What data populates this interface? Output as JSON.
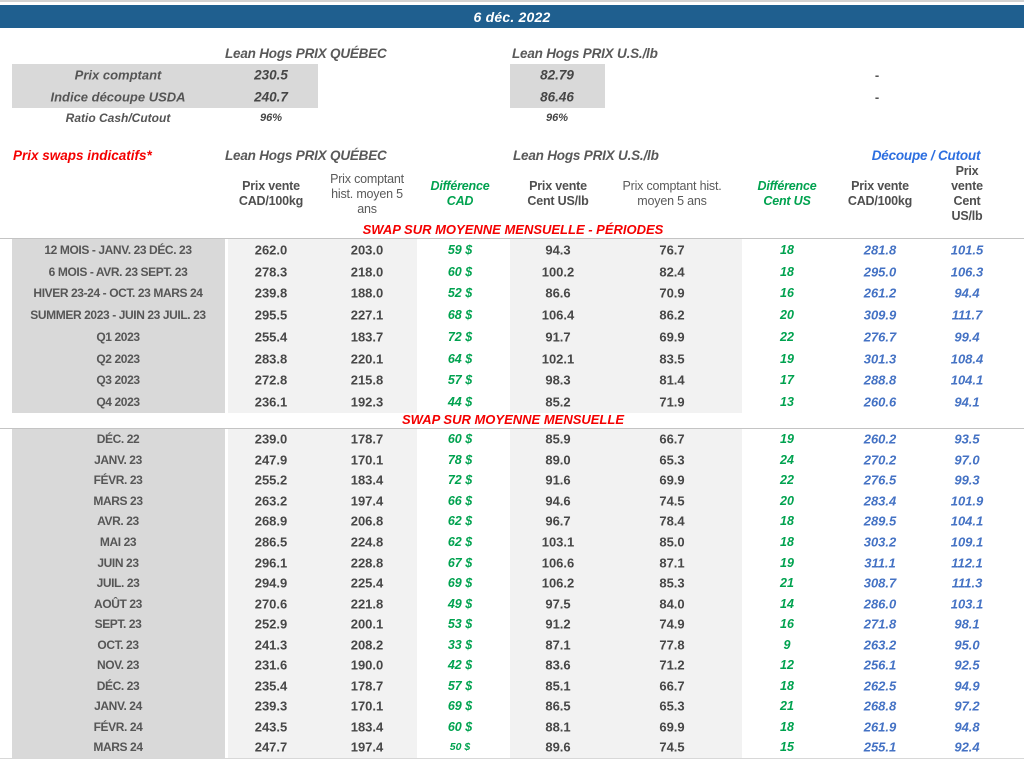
{
  "title_bar": {
    "date": "6 déc. 2022"
  },
  "colors": {
    "banner_blue": "#1f5f8f",
    "accent_red": "#f40000",
    "accent_green": "#00a24f",
    "value_blue": "#4472c4",
    "cutout_blue": "#2d6fe0",
    "label_band_grey": "#d9d9d9",
    "value_band_grey": "#f2f2f2"
  },
  "top_table": {
    "group_quebec": "Lean Hogs PRIX QUÉBEC",
    "group_us": "Lean Hogs PRIX U.S./lb",
    "rows": [
      {
        "label": "Prix comptant",
        "quebec": "230.5",
        "us": "82.79",
        "right": "-"
      },
      {
        "label": "Indice découpe USDA",
        "quebec": "240.7",
        "us": "86.46",
        "right": "-"
      },
      {
        "label": "Ratio Cash/Cutout",
        "quebec": "96%",
        "us": "96%",
        "right": ""
      }
    ]
  },
  "swaps": {
    "title": "Prix swaps indicatifs*",
    "group_quebec": "Lean Hogs PRIX QUÉBEC",
    "group_us": "Lean Hogs PRIX U.S./lb",
    "group_cutout": "Découpe / Cutout",
    "columns": [
      "Prix vente\nCAD/100kg",
      "Prix comptant\nhist. moyen 5\nans",
      "Différence\nCAD",
      "Prix vente\nCent US/lb",
      "Prix comptant hist.\nmoyen 5 ans",
      "Différence\nCent US",
      "Prix vente\nCAD/100kg",
      "Prix vente\nCent US/lb"
    ],
    "section1": {
      "title": "SWAP SUR MOYENNE MENSUELLE - PÉRIODES",
      "rows": [
        {
          "label": "12 MOIS - JANV. 23 DÉC. 23",
          "values": [
            "262.0",
            "203.0",
            "59 $",
            "94.3",
            "76.7",
            "18",
            "281.8",
            "101.5"
          ]
        },
        {
          "label": "6 MOIS - AVR. 23 SEPT. 23",
          "values": [
            "278.3",
            "218.0",
            "60 $",
            "100.2",
            "82.4",
            "18",
            "295.0",
            "106.3"
          ]
        },
        {
          "label": "HIVER 23-24 -  OCT. 23 MARS 24",
          "values": [
            "239.8",
            "188.0",
            "52 $",
            "86.6",
            "70.9",
            "16",
            "261.2",
            "94.4"
          ]
        },
        {
          "label": "SUMMER 2023 - JUIN 23 JUIL. 23",
          "values": [
            "295.5",
            "227.1",
            "68 $",
            "106.4",
            "86.2",
            "20",
            "309.9",
            "111.7"
          ]
        },
        {
          "label": "Q1 2023",
          "values": [
            "255.4",
            "183.7",
            "72 $",
            "91.7",
            "69.9",
            "22",
            "276.7",
            "99.4"
          ]
        },
        {
          "label": "Q2 2023",
          "values": [
            "283.8",
            "220.1",
            "64 $",
            "102.1",
            "83.5",
            "19",
            "301.3",
            "108.4"
          ]
        },
        {
          "label": "Q3 2023",
          "values": [
            "272.8",
            "215.8",
            "57 $",
            "98.3",
            "81.4",
            "17",
            "288.8",
            "104.1"
          ]
        },
        {
          "label": "Q4 2023",
          "values": [
            "236.1",
            "192.3",
            "44 $",
            "85.2",
            "71.9",
            "13",
            "260.6",
            "94.1"
          ]
        }
      ]
    },
    "section2": {
      "title": "SWAP SUR MOYENNE MENSUELLE",
      "rows": [
        {
          "label": "DÉC. 22",
          "values": [
            "239.0",
            "178.7",
            "60 $",
            "85.9",
            "66.7",
            "19",
            "260.2",
            "93.5"
          ]
        },
        {
          "label": "JANV. 23",
          "values": [
            "247.9",
            "170.1",
            "78 $",
            "89.0",
            "65.3",
            "24",
            "270.2",
            "97.0"
          ]
        },
        {
          "label": "FÉVR. 23",
          "values": [
            "255.2",
            "183.4",
            "72 $",
            "91.6",
            "69.9",
            "22",
            "276.5",
            "99.3"
          ]
        },
        {
          "label": "MARS 23",
          "values": [
            "263.2",
            "197.4",
            "66 $",
            "94.6",
            "74.5",
            "20",
            "283.4",
            "101.9"
          ]
        },
        {
          "label": "AVR. 23",
          "values": [
            "268.9",
            "206.8",
            "62 $",
            "96.7",
            "78.4",
            "18",
            "289.5",
            "104.1"
          ]
        },
        {
          "label": "MAI 23",
          "values": [
            "286.5",
            "224.8",
            "62 $",
            "103.1",
            "85.0",
            "18",
            "303.2",
            "109.1"
          ]
        },
        {
          "label": "JUIN 23",
          "values": [
            "296.1",
            "228.8",
            "67 $",
            "106.6",
            "87.1",
            "19",
            "311.1",
            "112.1"
          ]
        },
        {
          "label": "JUIL. 23",
          "values": [
            "294.9",
            "225.4",
            "69 $",
            "106.2",
            "85.3",
            "21",
            "308.7",
            "111.3"
          ]
        },
        {
          "label": "AOÛT 23",
          "values": [
            "270.6",
            "221.8",
            "49 $",
            "97.5",
            "84.0",
            "14",
            "286.0",
            "103.1"
          ]
        },
        {
          "label": "SEPT. 23",
          "values": [
            "252.9",
            "200.1",
            "53 $",
            "91.2",
            "74.9",
            "16",
            "271.8",
            "98.1"
          ]
        },
        {
          "label": "OCT. 23",
          "values": [
            "241.3",
            "208.2",
            "33 $",
            "87.1",
            "77.8",
            "9",
            "263.2",
            "95.0"
          ]
        },
        {
          "label": "NOV. 23",
          "values": [
            "231.6",
            "190.0",
            "42 $",
            "83.6",
            "71.2",
            "12",
            "256.1",
            "92.5"
          ]
        },
        {
          "label": "DÉC. 23",
          "values": [
            "235.4",
            "178.7",
            "57 $",
            "85.1",
            "66.7",
            "18",
            "262.5",
            "94.9"
          ]
        },
        {
          "label": "JANV. 24",
          "values": [
            "239.3",
            "170.1",
            "69 $",
            "86.5",
            "65.3",
            "21",
            "268.8",
            "97.2"
          ]
        },
        {
          "label": "FÉVR. 24",
          "values": [
            "243.5",
            "183.4",
            "60 $",
            "88.1",
            "69.9",
            "18",
            "261.9",
            "94.8"
          ]
        },
        {
          "label": "MARS 24",
          "values": [
            "247.7",
            "197.4",
            "50 $",
            "89.6",
            "74.5",
            "15",
            "255.1",
            "92.4"
          ],
          "small": true
        }
      ]
    }
  }
}
